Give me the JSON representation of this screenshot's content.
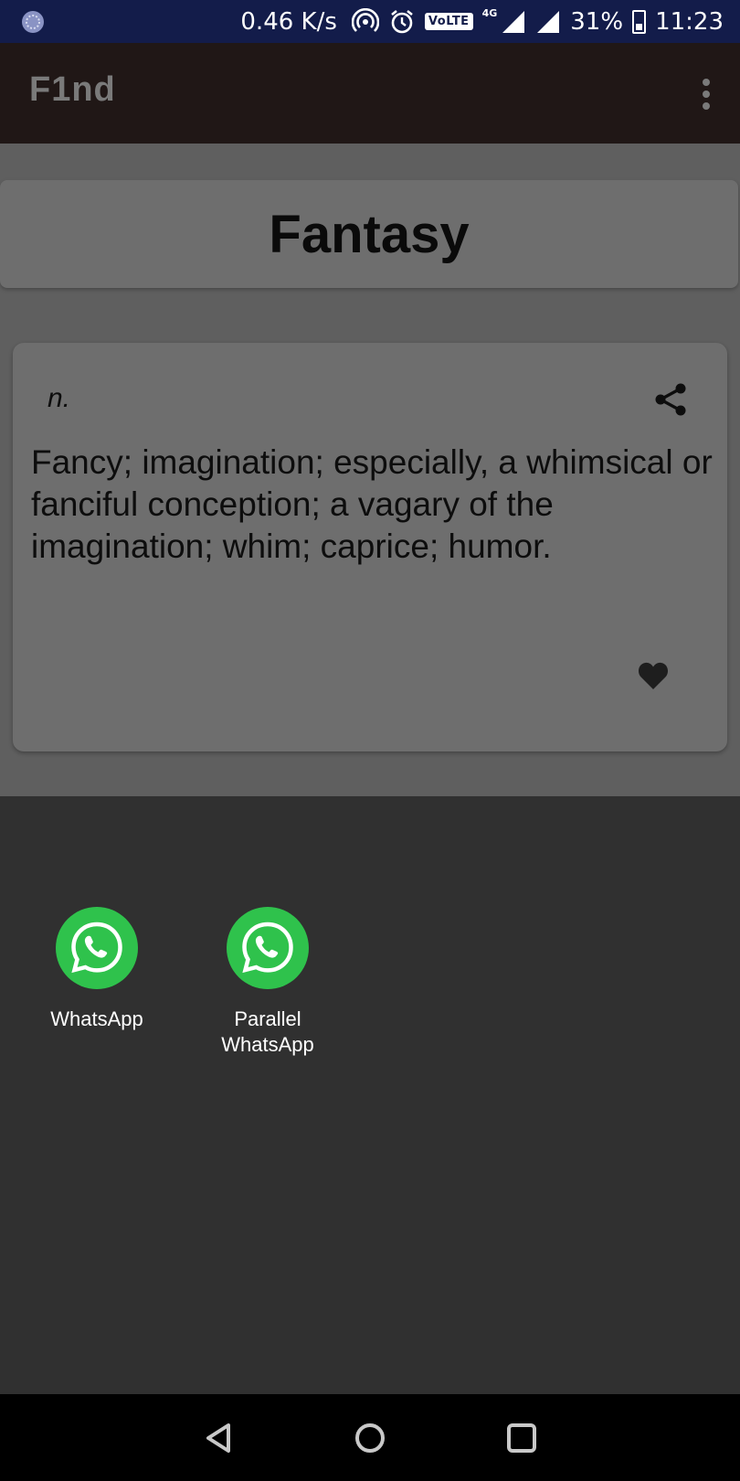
{
  "status_bar": {
    "net_speed": "0.46 K/s",
    "volte": "VoLTE",
    "network_type": "4G",
    "battery_percent": "31%",
    "time": "11:23"
  },
  "app_bar": {
    "title": "F1nd"
  },
  "word_card": {
    "word": "Fantasy"
  },
  "definition_card": {
    "part_of_speech": "n.",
    "definition": "Fancy; imagination; especially, a whimsical or fanciful conception; a vagary of the imagination; whim; caprice; humor."
  },
  "share_sheet": {
    "targets": [
      {
        "label": "WhatsApp",
        "icon": "whatsapp-icon"
      },
      {
        "label": "Parallel WhatsApp",
        "icon": "whatsapp-icon"
      }
    ]
  },
  "colors": {
    "status_bar_bg": "#131c4a",
    "app_bar_bg": "#201716",
    "sheet_bg": "#303030",
    "whatsapp_green": "#2fc24c"
  }
}
